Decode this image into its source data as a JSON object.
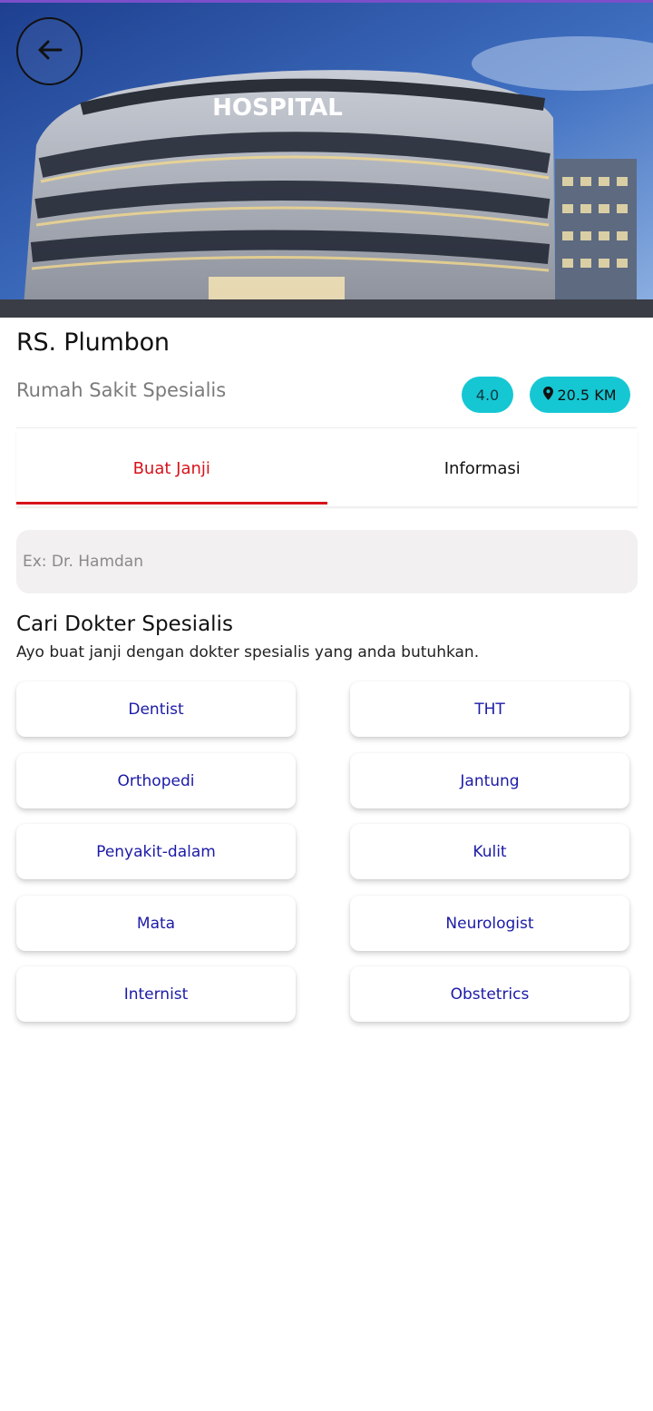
{
  "hero": {
    "sign_text": "HOSPITAL"
  },
  "header": {
    "name": "RS. Plumbon",
    "type": "Rumah Sakit Spesialis",
    "rating": "4.0",
    "distance": "20.5 KM"
  },
  "tabs": [
    {
      "label": "Buat Janji",
      "active": true
    },
    {
      "label": "Informasi",
      "active": false
    }
  ],
  "search": {
    "placeholder": "Ex: Dr. Hamdan",
    "value": ""
  },
  "section": {
    "title": "Cari Dokter Spesialis",
    "subtitle": "Ayo buat janji dengan dokter spesialis yang anda butuhkan."
  },
  "specialists": [
    "Dentist",
    "THT",
    "Orthopedi",
    "Jantung",
    "Penyakit-dalam",
    "Kulit",
    "Mata",
    "Neurologist",
    "Internist",
    "Obstetrics"
  ],
  "colors": {
    "accent": "#d6131b",
    "badge": "#15c7d3",
    "link": "#1b1aa7"
  },
  "icons": {
    "back": "arrow-left-icon",
    "location": "location-pin-icon"
  }
}
